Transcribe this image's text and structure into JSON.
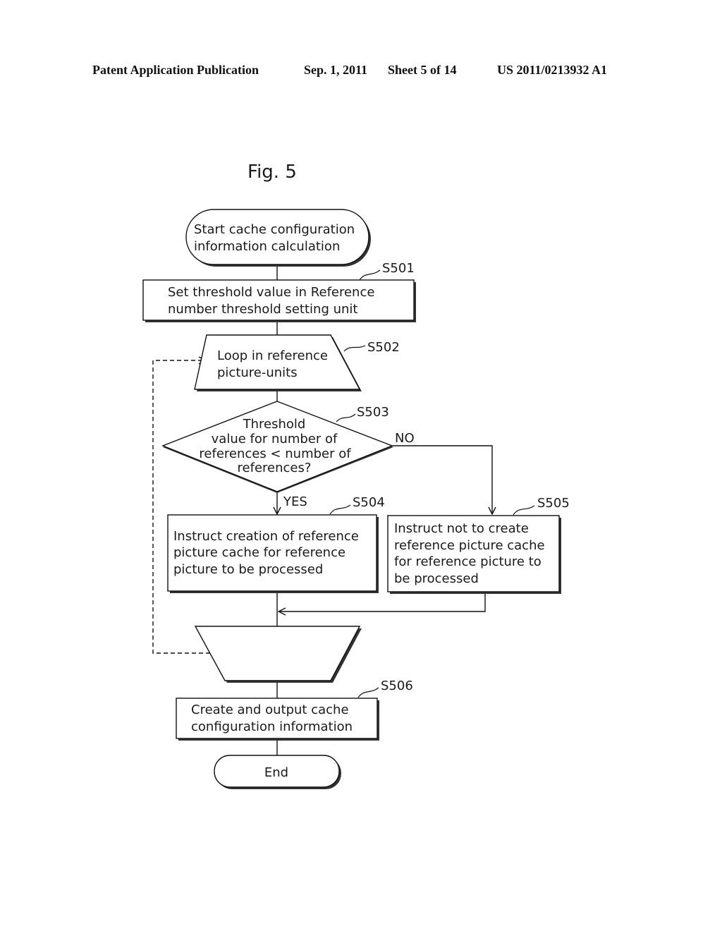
{
  "header": {
    "publication": "Patent Application Publication",
    "date": "Sep. 1, 2011",
    "sheet": "Sheet 5 of 14",
    "number": "US 2011/0213932 A1"
  },
  "figure": {
    "title": "Fig. 5",
    "start": [
      "Start cache configuration",
      "information calculation"
    ],
    "s501": {
      "label": "S501",
      "lines": [
        "Set threshold value in Reference",
        "number threshold setting unit"
      ]
    },
    "s502": {
      "label": "S502",
      "lines": [
        "Loop in reference",
        "picture-units"
      ]
    },
    "s503": {
      "label": "S503",
      "lines": [
        "Threshold",
        "value for number of",
        "references < number of",
        "references?"
      ],
      "no": "NO",
      "yes": "YES"
    },
    "s504": {
      "label": "S504",
      "lines": [
        "Instruct creation of reference",
        "picture cache for reference",
        "picture to be processed"
      ]
    },
    "s505": {
      "label": "S505",
      "lines": [
        "Instruct not to create",
        "reference picture cache",
        "for reference picture to",
        "be processed"
      ]
    },
    "s506": {
      "label": "S506",
      "lines": [
        "Create and output cache",
        "configuration information"
      ]
    },
    "end": "End"
  }
}
